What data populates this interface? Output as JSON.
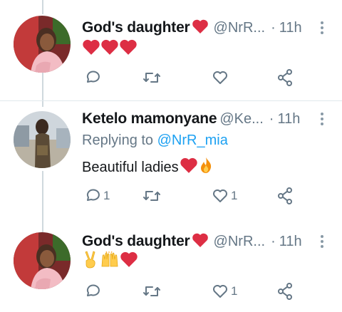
{
  "tweets": [
    {
      "name": "God's daughter",
      "handle": "@NrR...",
      "dot": "·",
      "time": "11h",
      "text": "",
      "emojis": [
        "heart",
        "heart",
        "heart"
      ],
      "reply_count": "",
      "retweet_count": "",
      "like_count": ""
    },
    {
      "name": "Ketelo mamonyane",
      "handle": "@Ke...",
      "dot": "·",
      "time": "11h",
      "replying_prefix": "Replying to",
      "replying_to": "@NrR_mia",
      "text": "Beautiful ladies",
      "emojis": [
        "heart",
        "fire"
      ],
      "reply_count": "1",
      "retweet_count": "",
      "like_count": "1"
    },
    {
      "name": "God's daughter",
      "handle": "@NrR...",
      "dot": "·",
      "time": "11h",
      "text": "",
      "emojis": [
        "victory-hand",
        "raised-hands",
        "heart"
      ],
      "reply_count": "",
      "retweet_count": "",
      "like_count": "1"
    }
  ],
  "colors": {
    "heart": "#dd2e44",
    "icon": "#657786",
    "mention": "#1da1f2",
    "thread": "#cfd9de"
  }
}
